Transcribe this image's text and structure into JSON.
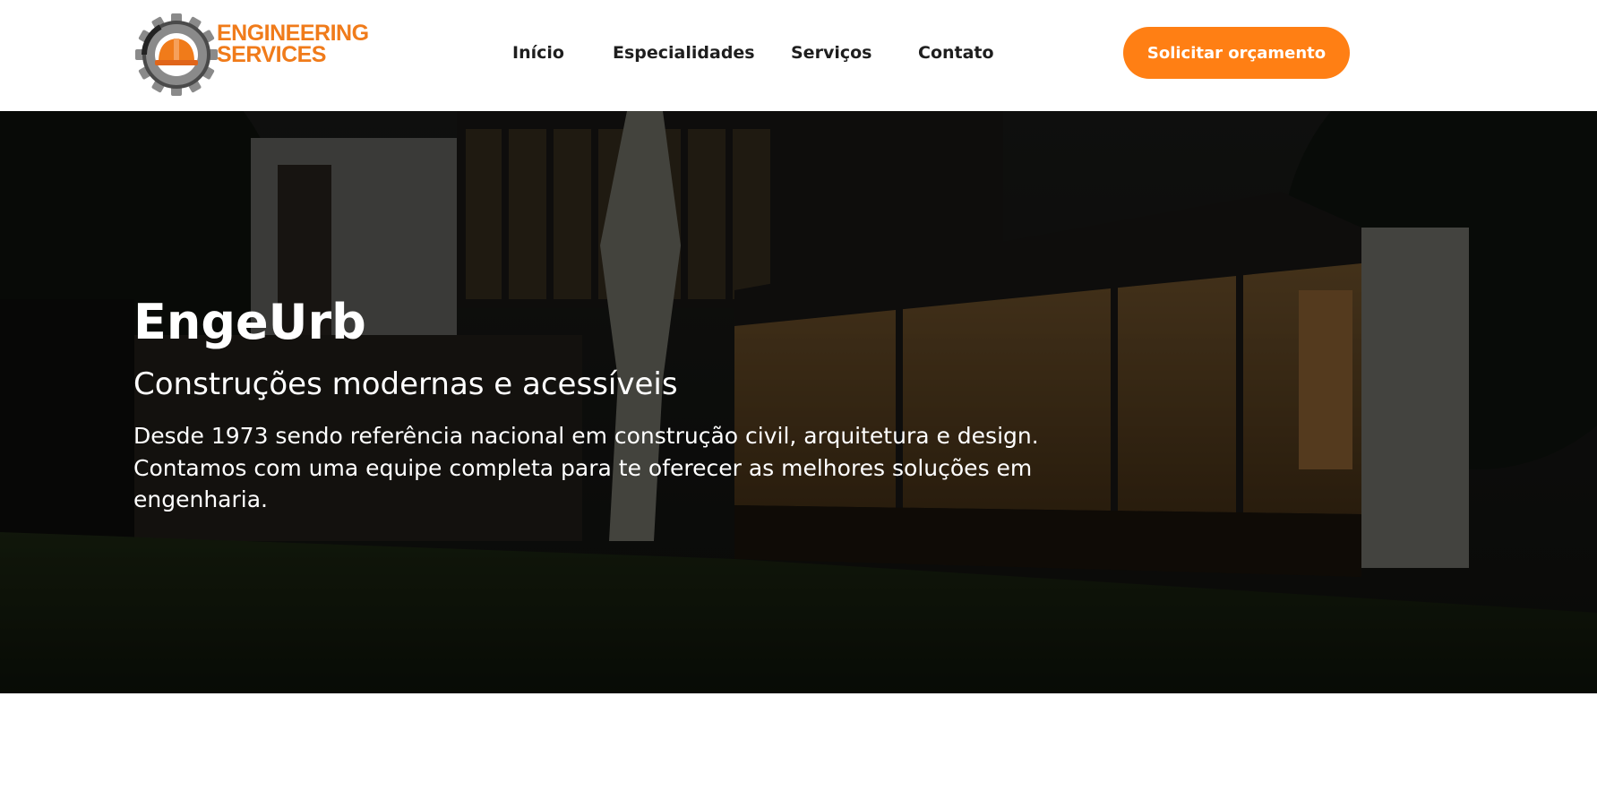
{
  "header": {
    "logo": {
      "line1": "ENGINEERING",
      "line2": "SERVICES",
      "icon": "gear-hardhat-logo"
    },
    "nav": [
      {
        "label": "Início"
      },
      {
        "label": "Especialidades"
      },
      {
        "label": "Serviços"
      },
      {
        "label": "Contato"
      }
    ],
    "cta_label": "Solicitar orçamento"
  },
  "hero": {
    "title": "EngeUrb",
    "subtitle": "Construções modernas e acessíveis",
    "description": "Desde 1973 sendo referência nacional em construção civil, arquitetura e design. Contamos com uma equipe completa para te oferecer as melhores soluções em engenharia."
  },
  "colors": {
    "accent": "#ff7f14",
    "logo_orange": "#f07b1a",
    "nav_text": "#1e1e1e",
    "hero_text": "#ffffff"
  }
}
